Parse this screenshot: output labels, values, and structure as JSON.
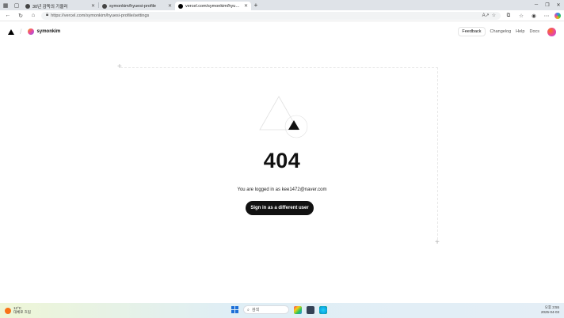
{
  "browser": {
    "tabs": [
      {
        "label": "30년 감독의 기울러",
        "active": false
      },
      {
        "label": "symonkim/hyuesi-profile",
        "active": false
      },
      {
        "label": "vercel.com/symonkim/hyuesi-pr",
        "active": true
      }
    ],
    "url": "https://vercel.com/symonkim/hyuesi-profile/settings"
  },
  "nav": {
    "team_name": "symonkim",
    "feedback": "Feedback",
    "changelog": "Changelog",
    "help": "Help",
    "docs": "Docs"
  },
  "error": {
    "code": "404",
    "logged_in_text": "You are logged in as kee1472@naver.com",
    "button": "Sign in as a different user"
  },
  "taskbar": {
    "weather_temp": "12°C",
    "weather_desc": "대체로 흐림",
    "search": "검색",
    "time": "오후 3:55",
    "date": "2025-04-03"
  },
  "colors": {
    "accent": "#111111",
    "tab_bar": "#dfe3e8"
  }
}
